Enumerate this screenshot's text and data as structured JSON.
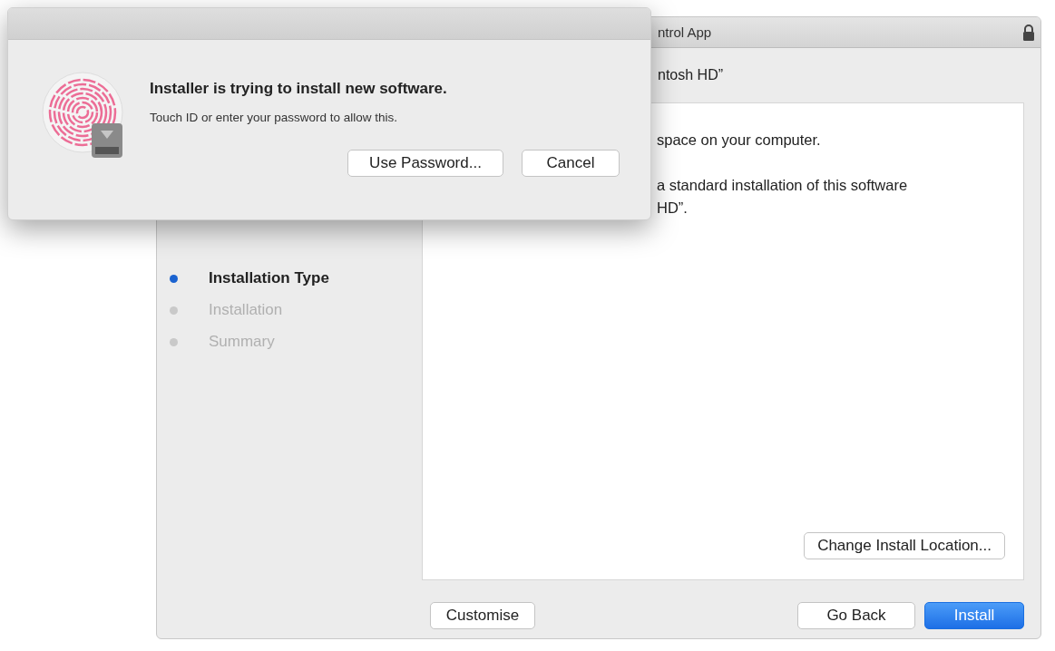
{
  "window": {
    "title": "ntrol App",
    "locked": true
  },
  "heading": "ntosh HD”",
  "steps": [
    {
      "label": "Installation Type",
      "selected": true
    },
    {
      "label": "Installation",
      "selected": false
    },
    {
      "label": "Summary",
      "selected": false
    }
  ],
  "content": {
    "lines": [
      "space on your computer.",
      "a standard installation of this software",
      "HD”."
    ],
    "location_button": "Change Install Location..."
  },
  "buttons": {
    "customise": "Customise",
    "go_back": "Go Back",
    "install": "Install"
  },
  "dialog": {
    "title": "Installer is trying to install new software.",
    "message": "Touch ID or enter your password to allow this.",
    "buttons": [
      "Use Password...",
      "Cancel"
    ]
  }
}
